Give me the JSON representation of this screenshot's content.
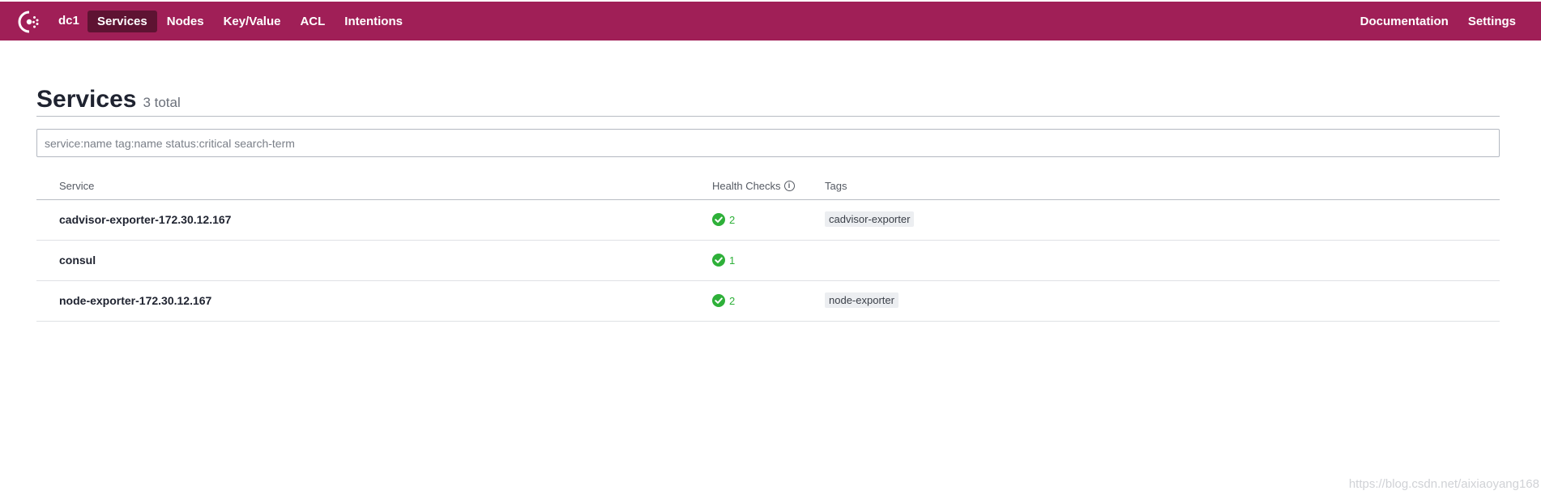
{
  "nav": {
    "datacenter": "dc1",
    "items": [
      {
        "label": "Services",
        "active": true
      },
      {
        "label": "Nodes"
      },
      {
        "label": "Key/Value"
      },
      {
        "label": "ACL"
      },
      {
        "label": "Intentions"
      }
    ],
    "right": [
      {
        "label": "Documentation"
      },
      {
        "label": "Settings"
      }
    ],
    "brand_color": "#a01f57",
    "active_color": "#5e1332"
  },
  "page": {
    "title": "Services",
    "total": "3 total"
  },
  "search": {
    "placeholder": "service:name tag:name status:critical search-term",
    "value": ""
  },
  "table": {
    "headers": {
      "service": "Service",
      "health": "Health Checks",
      "tags": "Tags"
    },
    "rows": [
      {
        "name": "cadvisor-exporter-172.30.12.167",
        "health": "2",
        "tag": "cadvisor-exporter"
      },
      {
        "name": "consul",
        "health": "1",
        "tag": ""
      },
      {
        "name": "node-exporter-172.30.12.167",
        "health": "2",
        "tag": "node-exporter"
      }
    ],
    "passing_color": "#2eb039"
  },
  "watermark": "https://blog.csdn.net/aixiaoyang168"
}
